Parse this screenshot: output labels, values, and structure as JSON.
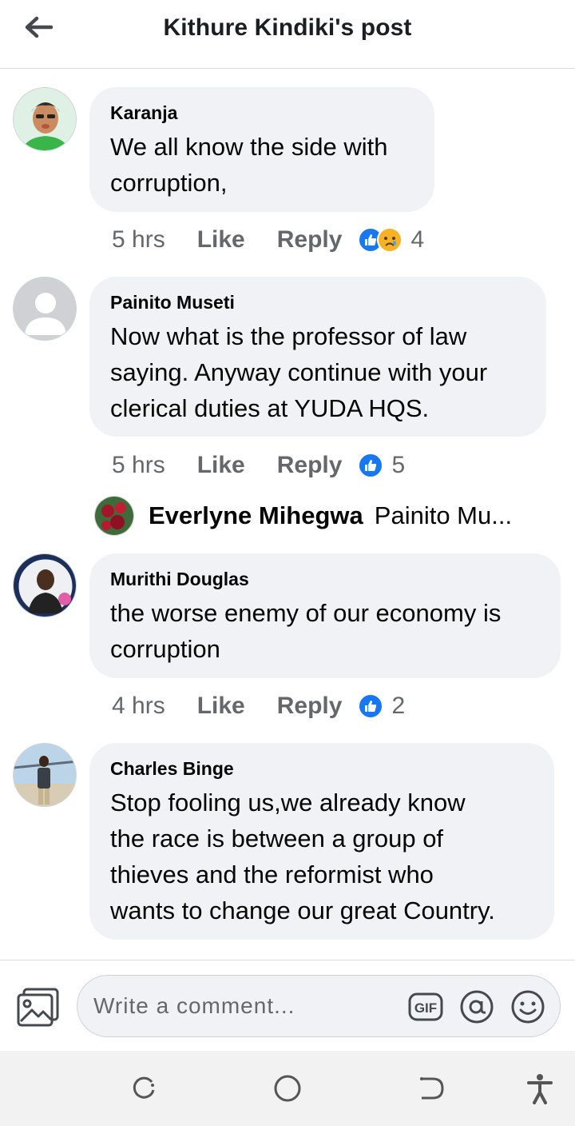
{
  "header": {
    "title": "Kithure Kindiki's post"
  },
  "comments": [
    {
      "author": "Karanja",
      "lines": [
        "We all know the side with",
        "corruption,"
      ],
      "time": "5 hrs",
      "like_label": "Like",
      "reply_label": "Reply",
      "reactions": [
        "like",
        "sad"
      ],
      "reaction_count": "4"
    },
    {
      "author": "Painito Museti",
      "lines": [
        "Now what is the professor of law",
        "saying. Anyway continue with your",
        "clerical duties at YUDA HQS."
      ],
      "time": "5 hrs",
      "like_label": "Like",
      "reply_label": "Reply",
      "reactions": [
        "like"
      ],
      "reaction_count": "5",
      "reply_preview": {
        "name": "Everlyne Mihegwa",
        "snippet": "Painito Mu..."
      }
    },
    {
      "author": "Murithi Douglas",
      "lines": [
        "the worse enemy of our economy is",
        "corruption"
      ],
      "time": "4 hrs",
      "like_label": "Like",
      "reply_label": "Reply",
      "reactions": [
        "like"
      ],
      "reaction_count": "2"
    },
    {
      "author": "Charles Binge",
      "lines": [
        "Stop fooling us,we already know",
        "the race is between a group of",
        "thieves and the reformist who",
        "wants to change our great Country."
      ]
    }
  ],
  "composer": {
    "placeholder": "Write a comment..."
  },
  "colors": {
    "accent": "#1877f2",
    "bubble": "#f0f2f5",
    "meta_text": "#65676b"
  },
  "icons": [
    "back-arrow-icon",
    "like-reaction-icon",
    "sad-reaction-icon",
    "photo-icon",
    "gif-icon",
    "mention-icon",
    "emoji-icon",
    "recents-icon",
    "home-icon",
    "back-icon",
    "accessibility-icon"
  ]
}
